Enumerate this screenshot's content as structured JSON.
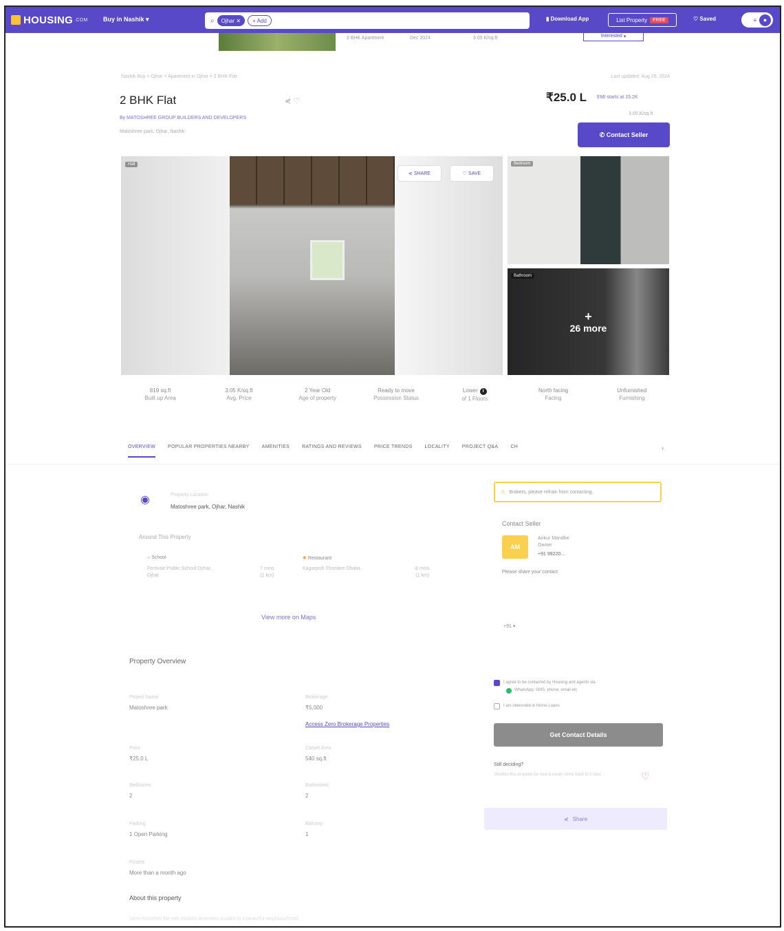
{
  "header": {
    "logo": "HOUSING",
    "logo_suffix": ".COM",
    "city": "Buy in Nashik",
    "search_chip": "Ojhar",
    "add_chip": "+ Add",
    "download_app": "Download App",
    "list_property": "List Property",
    "free_badge": "FREE",
    "saved": "Saved"
  },
  "strip": {
    "config": "2 BHK Apartment",
    "possession": "Dec 2024",
    "area": "3.05 K/sq.ft",
    "button": "Interested"
  },
  "breadcrumb": "Nashik Buy > Ojhar > Apartment in Ojhar > 2 BHK Flat",
  "posted": "Last updated: Aug 26, 2024",
  "listing": {
    "title": "2 BHK Flat",
    "builder": "By MATOSHREE GROUP BUILDERS AND DEVELOPERS",
    "locality": "Matoshree park, Ojhar, Nashik",
    "price": "₹25.0 L",
    "emi": "EMI starts at 15.2K",
    "price_per_sqft": "3.05 K/sq.ft",
    "contact_button": "Contact Seller"
  },
  "gallery": {
    "main_tag": "Hall",
    "share": "SHARE",
    "save": "SAVE",
    "side1_tag": "Bedroom",
    "side2_tag": "Bathroom",
    "more_label": "26 more"
  },
  "stats": [
    {
      "value": "819 sq.ft",
      "label": "Built up Area"
    },
    {
      "value": "3.05 K/sq.ft",
      "label": "Avg. Price"
    },
    {
      "value": "2 Year Old",
      "label": "Age of property"
    },
    {
      "value": "Ready to move",
      "label": "Possession Status"
    },
    {
      "value": "Lower",
      "label": "of 1 Floors"
    },
    {
      "value": "North facing",
      "label": "Facing"
    },
    {
      "value": "Unfurnished",
      "label": "Furnishing"
    }
  ],
  "tabs": [
    "OVERVIEW",
    "POPULAR PROPERTIES NEARBY",
    "AMENITIES",
    "RATINGS AND REVIEWS",
    "PRICE TRENDS",
    "LOCALITY",
    "PROJECT Q&A",
    "CH"
  ],
  "location": {
    "label": "Property Location",
    "address": "Matoshree park, Ojhar, Nashik",
    "around_title": "Around This Property",
    "poi1_type": "School",
    "poi1_name": "Fertivale Public School Ozhar, Ojhar",
    "poi1_dist": "7 mins",
    "poi1_unit": "(1 km)",
    "poi2_type": "Restaurant",
    "poi2_name": "Kagarpish Thombre Dhaba",
    "poi2_dist": "8 mins",
    "poi2_unit": "(1 km)",
    "map_link": "View more on Maps"
  },
  "overview": {
    "title": "Property Overview",
    "items": [
      {
        "k": "Project Name",
        "v": "Matoshree park"
      },
      {
        "k": "Brokerage",
        "v": "₹5,000"
      },
      {
        "k": "Price",
        "v": "₹25.0 L"
      },
      {
        "k": "Carpet Area",
        "v": "540 sq.ft"
      },
      {
        "k": "Bedrooms",
        "v": "2"
      },
      {
        "k": "Bathrooms",
        "v": "2"
      },
      {
        "k": "Parking",
        "v": "1 Open Parking"
      },
      {
        "k": "Balcony",
        "v": "1"
      },
      {
        "k": "Posted",
        "v": "More than a month ago"
      }
    ],
    "zero_brokerage_link": "Access Zero Brokerage Properties"
  },
  "about_title": "About this property",
  "about_text": "Semi-furnished flat with modern amenities located in a peaceful neighbourhood.",
  "contact_panel": {
    "warning": "Brokers, please refrain from contacting.",
    "title": "Contact Seller",
    "avatar": "AM",
    "name": "Ankur Mandhe",
    "role": "Owner",
    "phone": "+91 99220...",
    "share_prompt": "Please share your contact",
    "country_code": "+91",
    "agree": "I agree to be contacted by Housing and agents via",
    "channels": "WhatsApp, SMS, phone, email etc",
    "interested": "I am interested in Home Loans",
    "get_button": "Get Contact Details",
    "still": "Still deciding?",
    "still_sub": "Shortlist this property for now & easily come back to it later.",
    "share_button": "Share"
  }
}
